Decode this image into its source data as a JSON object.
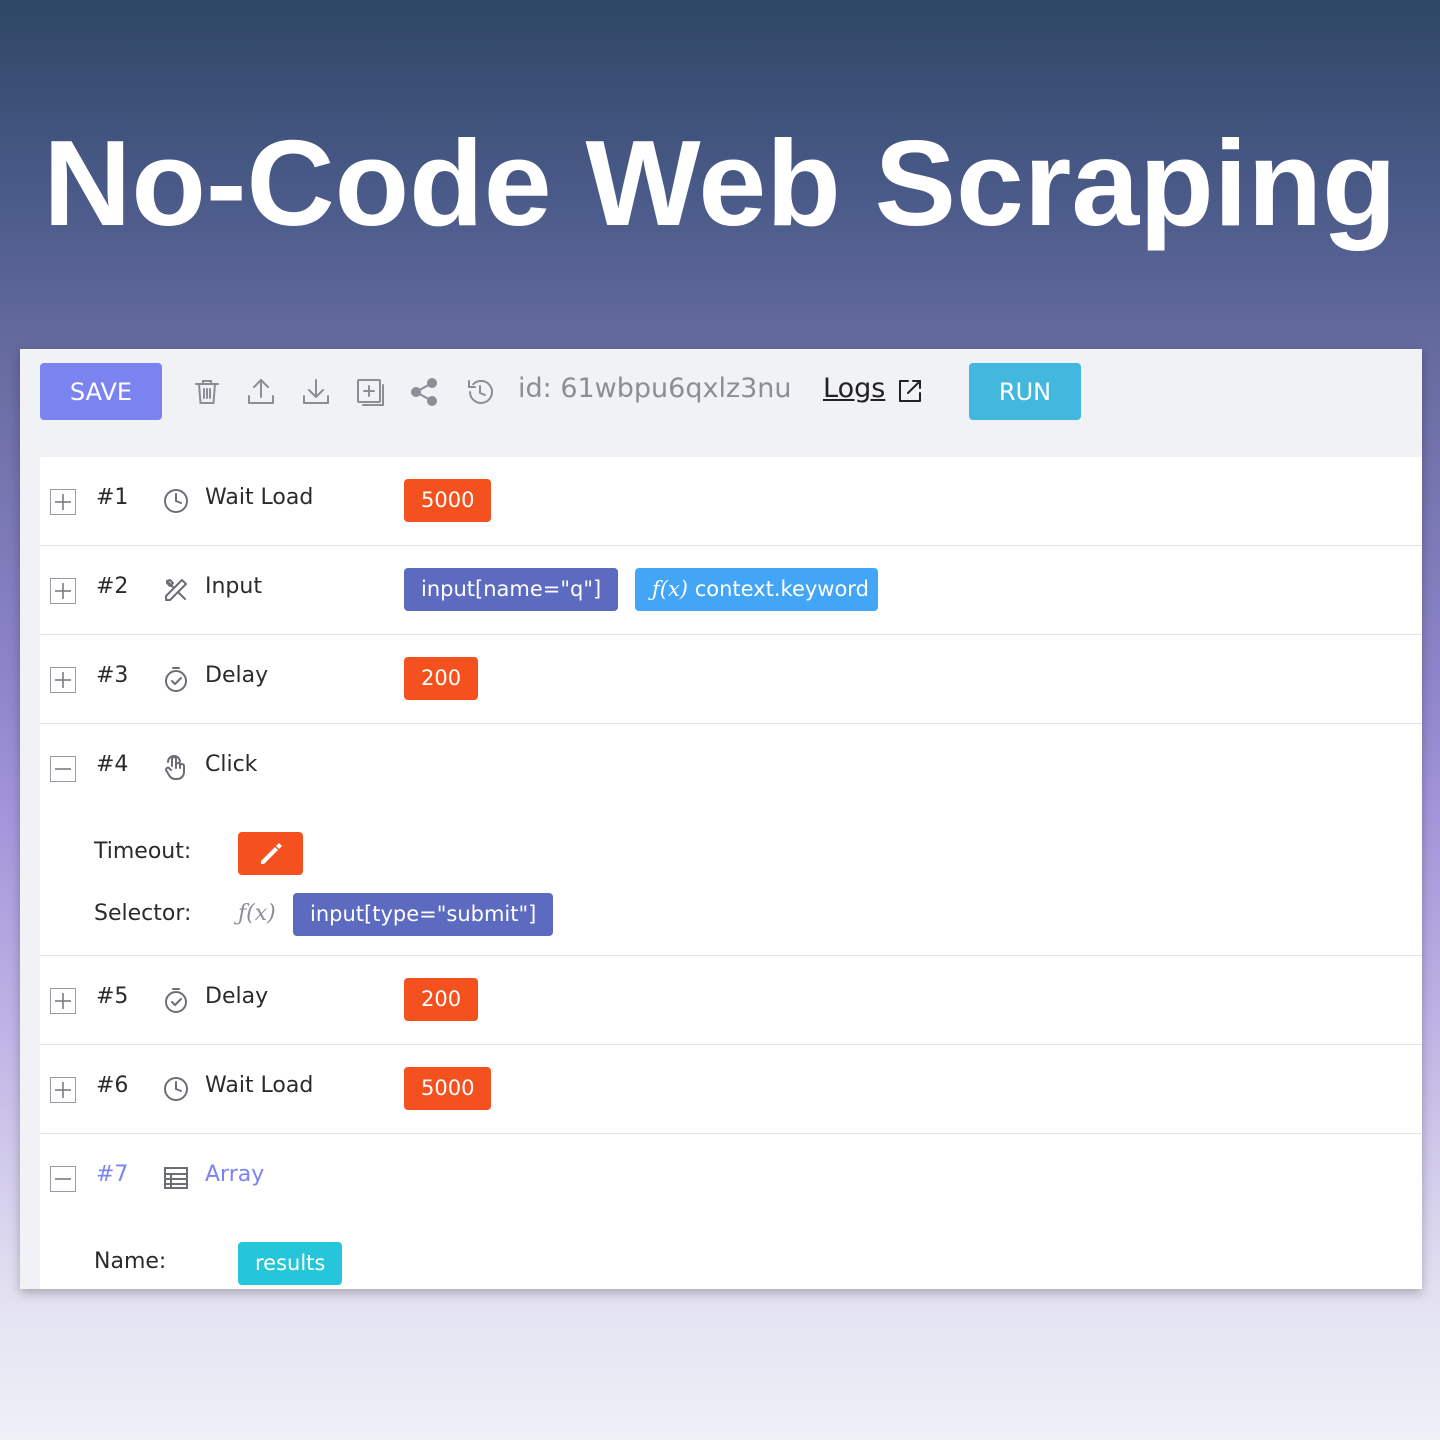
{
  "hero": {
    "title": "No-Code Web Scraping"
  },
  "toolbar": {
    "save_label": "SAVE",
    "run_label": "RUN",
    "id_text": "id: 61wbpu6qxlz3nu",
    "logs_label": "Logs",
    "icons": [
      "trash-icon",
      "upload-icon",
      "download-icon",
      "add-box-icon",
      "share-icon",
      "history-icon",
      "external-link-icon"
    ]
  },
  "steps": [
    {
      "num": "#1",
      "icon": "clock-icon",
      "label": "Wait Load",
      "tags": [
        "5000"
      ]
    },
    {
      "num": "#2",
      "icon": "input-tool-icon",
      "label": "Input",
      "tags": [
        "input[name=\"q\"]",
        "context.keyword"
      ],
      "fx_symbol": "ƒ(x)"
    },
    {
      "num": "#3",
      "icon": "timer-icon",
      "label": "Delay",
      "tags": [
        "200"
      ]
    },
    {
      "num": "#4",
      "icon": "tap-icon",
      "label": "Click",
      "expanded": true,
      "params": {
        "timeout_label": "Timeout:",
        "selector_label": "Selector:",
        "fx_symbol": "ƒ(x)",
        "selector_value": "input[type=\"submit\"]"
      }
    },
    {
      "num": "#5",
      "icon": "timer-icon",
      "label": "Delay",
      "tags": [
        "200"
      ]
    },
    {
      "num": "#6",
      "icon": "clock-icon",
      "label": "Wait Load",
      "tags": [
        "5000"
      ]
    },
    {
      "num": "#7",
      "icon": "table-icon",
      "label": "Array",
      "expanded": true,
      "active": true,
      "params": {
        "name_label": "Name:",
        "name_value": "results"
      }
    }
  ],
  "colors": {
    "save": "#7a83f0",
    "run": "#43b8de",
    "orange": "#f4511e",
    "indigo": "#5c6bc0",
    "blue": "#42a5f5",
    "cyan": "#26c6da",
    "active": "#7a83f0"
  }
}
